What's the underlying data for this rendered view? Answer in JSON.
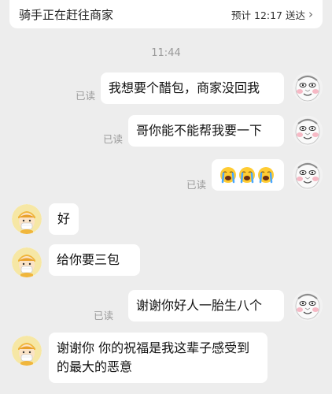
{
  "header": {
    "title": "骑手正在赶往商家",
    "eta": "预计 12:17 送达",
    "chevron": "›"
  },
  "time_divider": "11:44",
  "colors": {
    "background": "#ededed",
    "bubble": "#ffffff",
    "read_receipt": "#9a9a9a"
  },
  "messages": [
    {
      "side": "right",
      "text": "我想要个醋包，商家没回我",
      "status": "已读",
      "avatar": "meme-face-avatar"
    },
    {
      "side": "right",
      "text": "哥你能不能帮我要一下",
      "status": "已读",
      "avatar": "meme-face-avatar"
    },
    {
      "side": "right",
      "text": "",
      "emoji": [
        "crying-face-icon",
        "crying-face-icon",
        "crying-face-icon"
      ],
      "status": "已读",
      "avatar": "meme-face-avatar"
    },
    {
      "side": "left",
      "text": "好",
      "avatar": "masked-rider-avatar"
    },
    {
      "side": "left",
      "text": "给你要三包",
      "avatar": "masked-rider-avatar"
    },
    {
      "side": "right",
      "text": "谢谢你好人一胎生八个",
      "status": "已读",
      "avatar": "meme-face-avatar"
    },
    {
      "side": "left",
      "text": "谢谢你 你的祝福是我这辈子感受到的最大的恶意",
      "avatar": "masked-rider-avatar"
    }
  ]
}
